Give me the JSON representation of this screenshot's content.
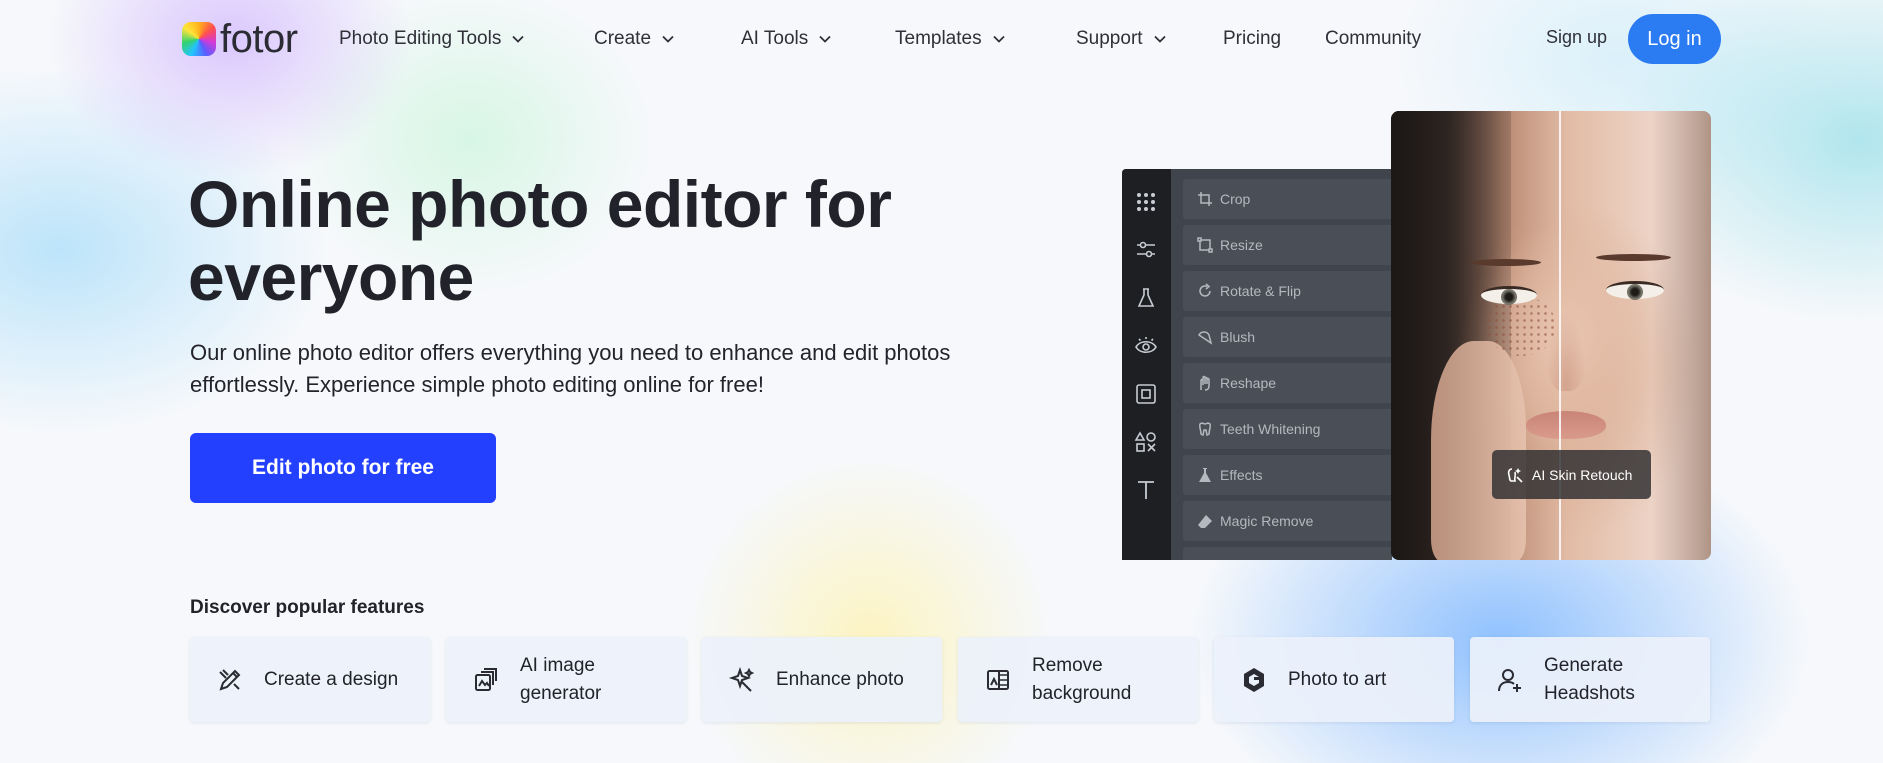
{
  "brand": {
    "name": "fotor"
  },
  "nav": {
    "menu": [
      {
        "label": "Photo Editing Tools",
        "dropdown": true
      },
      {
        "label": "Create",
        "dropdown": true
      },
      {
        "label": "AI Tools",
        "dropdown": true
      },
      {
        "label": "Templates",
        "dropdown": true
      },
      {
        "label": "Support",
        "dropdown": true
      },
      {
        "label": "Pricing",
        "dropdown": false
      },
      {
        "label": "Community",
        "dropdown": false
      }
    ],
    "signup_label": "Sign up",
    "login_label": "Log in"
  },
  "hero": {
    "title": "Online photo editor for everyone",
    "subtitle": "Our online photo editor offers everything you need to enhance and edit photos effortlessly. Experience simple photo editing online for free!",
    "cta_label": "Edit photo for free"
  },
  "editor_preview": {
    "rail_icons": [
      "apps-grid-icon",
      "adjust-sliders-icon",
      "beaker-icon",
      "eye-icon",
      "frame-icon",
      "shapes-icon",
      "text-icon"
    ],
    "tools": [
      {
        "label": "Crop",
        "icon": "crop-icon"
      },
      {
        "label": "Resize",
        "icon": "resize-icon"
      },
      {
        "label": "Rotate & Flip",
        "icon": "rotate-icon"
      },
      {
        "label": "Blush",
        "icon": "blush-icon"
      },
      {
        "label": "Reshape",
        "icon": "reshape-icon"
      },
      {
        "label": "Teeth Whitening",
        "icon": "teeth-whitening-icon"
      },
      {
        "label": "Effects",
        "icon": "effects-icon"
      },
      {
        "label": "Magic Remove",
        "icon": "eraser-icon"
      }
    ],
    "badge_label": "AI Skin Retouch"
  },
  "features": {
    "title": "Discover popular features",
    "items": [
      {
        "label": "Create a design",
        "icon": "design-pen-icon"
      },
      {
        "label": "AI image generator",
        "icon": "ai-image-icon"
      },
      {
        "label": "Enhance photo",
        "icon": "enhance-sparkle-icon"
      },
      {
        "label": "Remove background",
        "icon": "remove-background-icon"
      },
      {
        "label": "Photo to art",
        "icon": "photo-to-art-icon"
      },
      {
        "label": "Generate Headshots",
        "icon": "headshot-icon"
      }
    ]
  },
  "colors": {
    "login_button": "#2b7bf2",
    "cta_button": "#2440ff",
    "text_dark": "#22232a"
  }
}
